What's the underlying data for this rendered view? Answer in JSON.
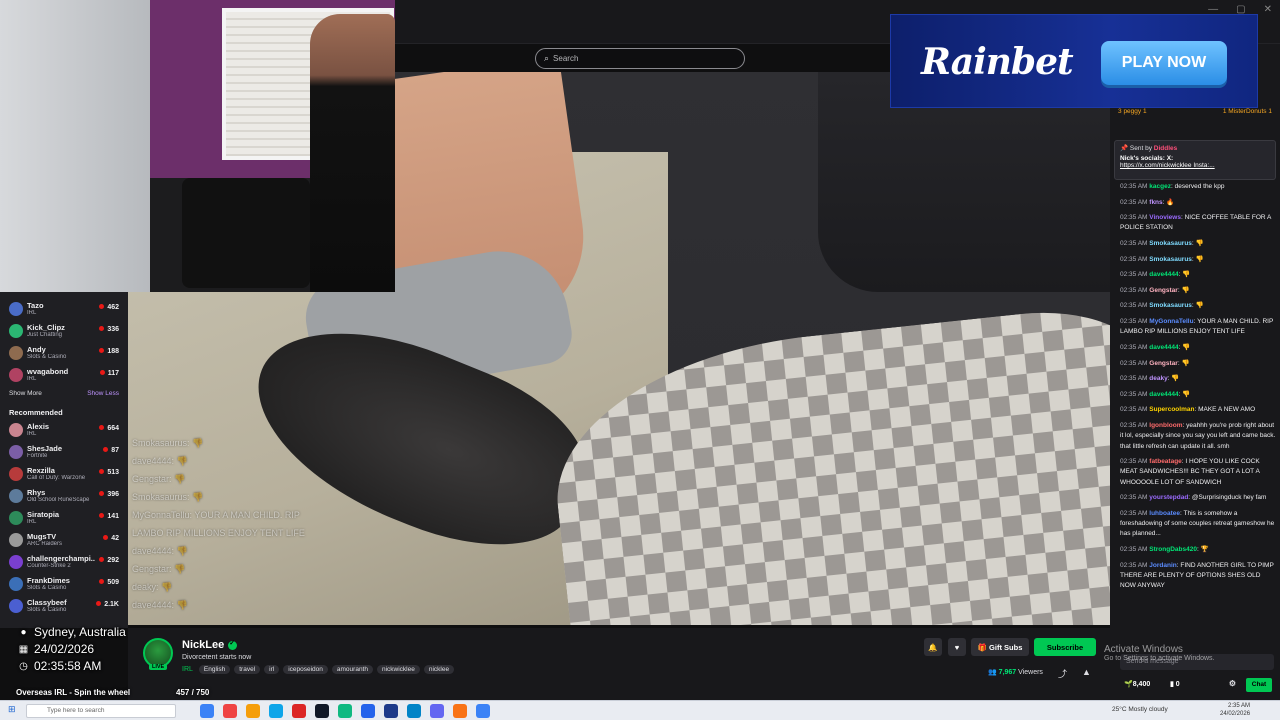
{
  "search": {
    "placeholder": "Search"
  },
  "ad": {
    "logo": "Rainbet",
    "cta": "PLAY NOW"
  },
  "sidebar": {
    "top_items": [
      {
        "name": "Tazo",
        "category": "IRL",
        "viewers": "462",
        "color": "#4a6cc7"
      },
      {
        "name": "Kick_Clipz",
        "category": "Just Chatting",
        "viewers": "336",
        "color": "#2bb673"
      },
      {
        "name": "Andy",
        "category": "Slots & Casino",
        "viewers": "188",
        "color": "#8e6b4f"
      },
      {
        "name": "wvagabond",
        "category": "IRL",
        "viewers": "117",
        "color": "#b04262"
      }
    ],
    "show_more": "Show More",
    "show_less": "Show Less",
    "recommended_heading": "Recommended",
    "recommended": [
      {
        "name": "Alexis",
        "category": "IRL",
        "viewers": "664",
        "color": "#c9848f"
      },
      {
        "name": "ShesJade",
        "category": "Fortnite",
        "viewers": "87",
        "color": "#7b5ea6"
      },
      {
        "name": "Rexzilla",
        "category": "Call of Duty: Warzone",
        "viewers": "513",
        "color": "#b73b3b"
      },
      {
        "name": "Rhys",
        "category": "Old School RuneScape",
        "viewers": "396",
        "color": "#5d7b9b"
      },
      {
        "name": "Siratopia",
        "category": "IRL",
        "viewers": "141",
        "color": "#2d8a5a"
      },
      {
        "name": "MugsTV",
        "category": "ARC Raiders",
        "viewers": "42",
        "color": "#9a9a9a"
      },
      {
        "name": "challengerchampi...",
        "category": "Counter-Strike 2",
        "viewers": "292",
        "color": "#7a3fd0"
      },
      {
        "name": "FrankDimes",
        "category": "Slots & Casino",
        "viewers": "509",
        "color": "#3b6fb7"
      },
      {
        "name": "Classybeef",
        "category": "Slots & Casino",
        "viewers": "2.1K",
        "color": "#4b5fd1"
      }
    ]
  },
  "overlay": {
    "location": "Sydney, Australia",
    "date": "24/02/2026",
    "time": "02:35:58 AM"
  },
  "goal": {
    "label": "Overseas IRL - Spin the wheel",
    "count": "457 / 750",
    "progress": 0.609
  },
  "stream": {
    "streamer": "NickLee",
    "live_label": "LIVE",
    "title": "Divorcetent starts now",
    "category": "IRL",
    "tags": [
      "English",
      "travel",
      "irl",
      "iceposeidon",
      "amouranth",
      "nickwicklee",
      "nicklee"
    ],
    "gift_label": "Gift Subs",
    "subscribe_label": "Subscribe",
    "viewers": "7,967",
    "viewers_label": "Viewers"
  },
  "chat_overlay_lines": [
    "Smokasaurus: 👎",
    "dave4444: 👎",
    "Gengstar: 👎",
    "Smokasaurus: 👎",
    "MyGonnaTellu: YOUR A MAN CHILD. RIP",
    "LAMBO RIP MILLIONS ENJOY TENT LIFE",
    "dave4444: 👎",
    "Gengstar: 👎",
    "deaky: 👎",
    "dave4444: 👎"
  ],
  "chat": {
    "leaderboard": [
      {
        "rank": "3",
        "name": "peggy",
        "count": "1"
      },
      {
        "rank": "1",
        "name": "MisterDonuts",
        "count": "1"
      }
    ],
    "pinned_by_label": "Sent by",
    "pinned_by": "Diddles",
    "pinned_text": "Nick's socials: X:",
    "pinned_link": "https://x.com/nickwicklee Insta:...",
    "messages": [
      {
        "time": "02:35 AM",
        "user": "kacgez",
        "color": "#00e676",
        "text": "deserved the kpp"
      },
      {
        "time": "02:35 AM",
        "user": "fkns",
        "color": "#bf94ff",
        "text": "🔥"
      },
      {
        "time": "02:35 AM",
        "user": "Vinoviews",
        "color": "#9b6bff",
        "text": "NICE COFFEE TABLE FOR A POLICE STATION"
      },
      {
        "time": "02:35 AM",
        "user": "Smokasaurus",
        "color": "#7fdbff",
        "text": "👎"
      },
      {
        "time": "02:35 AM",
        "user": "Smokasaurus",
        "color": "#7fdbff",
        "text": "👎"
      },
      {
        "time": "02:35 AM",
        "user": "dave4444",
        "color": "#00e676",
        "text": "👎"
      },
      {
        "time": "02:35 AM",
        "user": "Gengstar",
        "color": "#ffb3c1",
        "text": "👎"
      },
      {
        "time": "02:35 AM",
        "user": "Smokasaurus",
        "color": "#7fdbff",
        "text": "👎"
      },
      {
        "time": "02:35 AM",
        "user": "MyGonnaTellu",
        "color": "#5b8cff",
        "text": "YOUR A MAN CHILD. RIP LAMBO RIP MILLIONS ENJOY TENT LIFE"
      },
      {
        "time": "02:35 AM",
        "user": "dave4444",
        "color": "#00e676",
        "text": "👎"
      },
      {
        "time": "02:35 AM",
        "user": "Gengstar",
        "color": "#ffb3c1",
        "text": "👎"
      },
      {
        "time": "02:35 AM",
        "user": "deaky",
        "color": "#bf94ff",
        "text": "👎"
      },
      {
        "time": "02:35 AM",
        "user": "dave4444",
        "color": "#00e676",
        "text": "👎"
      },
      {
        "time": "02:35 AM",
        "user": "Supercoolman",
        "color": "#ffd400",
        "text": "MAKE A NEW AMO"
      },
      {
        "time": "02:35 AM",
        "user": "Igonbloom",
        "color": "#ff6b6b",
        "text": "yeahhh you're prob right about it lol, especially since you say you left and came back. that little refresh can update it all. smh"
      },
      {
        "time": "02:35 AM",
        "user": "fatbeatage",
        "color": "#ff6b6b",
        "text": "I HOPE YOU LIKE COCK MEAT SANDWICHES!!! BC THEY GOT A LOT A WHOOOOLE LOT OF SANDWICH"
      },
      {
        "time": "02:35 AM",
        "user": "yourstepdad",
        "color": "#9b6bff",
        "text": "@Surprisingduck hey fam"
      },
      {
        "time": "02:35 AM",
        "user": "luhboatee",
        "color": "#5b8cff",
        "text": "This is somehow a foreshadowing of some couples retreat gameshow he has planned..."
      },
      {
        "time": "02:35 AM",
        "user": "StrongDabs420",
        "color": "#00e676",
        "text": "🏆"
      },
      {
        "time": "02:35 AM",
        "user": "Jordanin",
        "color": "#5b8cff",
        "text": "FIND ANOTHER GIRL TO PIMP THERE ARE PLENTY OF OPTIONS SHES OLD NOW ANYWAY"
      }
    ],
    "input_placeholder": "Send a message",
    "points": "8,400",
    "points2": "0",
    "chat_button": "Chat"
  },
  "activate_windows": {
    "title": "Activate Windows",
    "subtitle": "Go to Settings to activate Windows."
  },
  "taskbar": {
    "search_placeholder": "Type here to search",
    "weather": "25°C  Mostly cloudy",
    "clock_time": "2:35 AM",
    "clock_date": "24/02/2026",
    "icons": [
      "#3b82f6",
      "#ef4444",
      "#f59e0b",
      "#0ea5e9",
      "#dc2626",
      "#111827",
      "#10b981",
      "#2563eb",
      "#1e3a8a",
      "#0284c7",
      "#6366f1",
      "#f97316",
      "#3b82f6"
    ]
  }
}
